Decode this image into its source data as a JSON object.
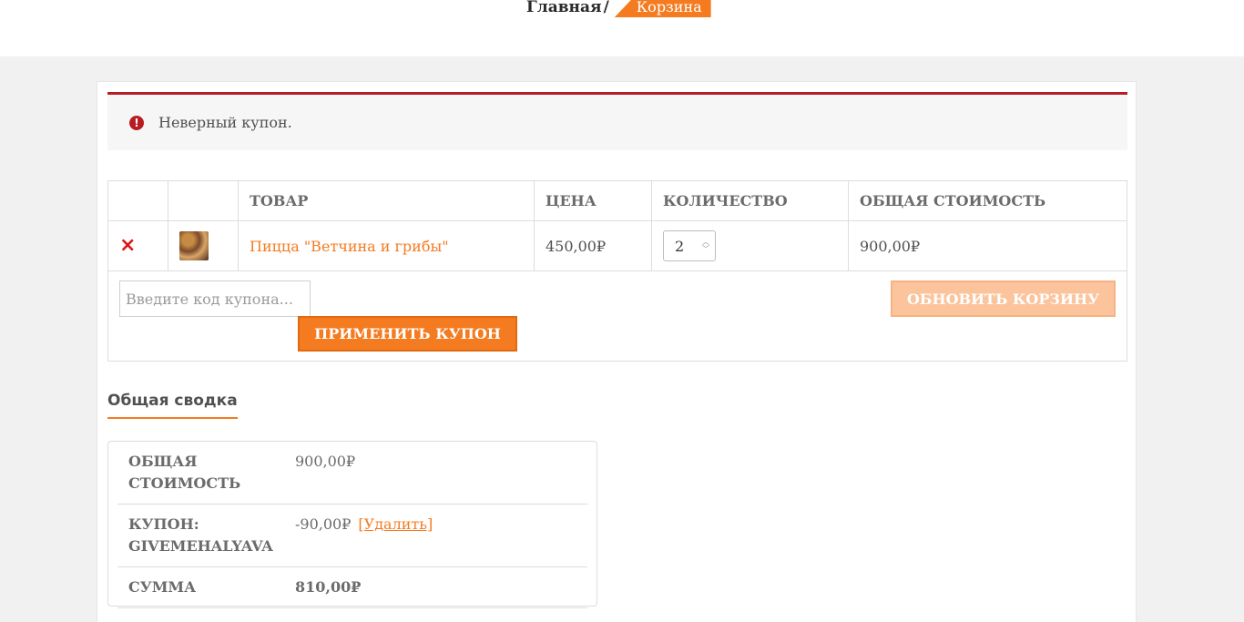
{
  "breadcrumb": {
    "home": "Главная",
    "separator": "/",
    "current": "Корзина"
  },
  "notice": {
    "icon": "error-icon",
    "text": "Неверный купон."
  },
  "cart": {
    "headers": [
      "",
      "",
      "Товар",
      "Цена",
      "Количество",
      "Общая стоимость"
    ],
    "items": [
      {
        "remove_symbol": "×",
        "thumbnail_icon": "pizza-thumbnail",
        "name": "Пицца \"Ветчина и грибы\"",
        "price": "450,00₽",
        "quantity": "2",
        "subtotal": "900,00₽"
      }
    ],
    "coupon_placeholder": "Введите код купона...",
    "apply_label": "Применить купон",
    "update_label": "Обновить корзину"
  },
  "summary": {
    "title": "Общая сводка",
    "subtotal_label": "Общая стоимость",
    "subtotal_value": "900,00₽",
    "coupon_label": "Купон: givemehalyava",
    "coupon_value": "-90,00₽",
    "coupon_remove": "[Удалить]",
    "total_label": "Сумма",
    "total_value": "810,00₽"
  },
  "colors": {
    "accent": "#f47b20",
    "error": "#b81c23",
    "remove": "#e01414"
  }
}
